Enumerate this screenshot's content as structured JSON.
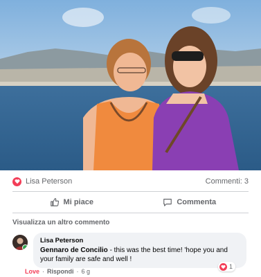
{
  "post": {
    "reaction_name": "Lisa Peterson",
    "comments_count": "Commenti: 3",
    "like_label": "Mi piace",
    "comment_label": "Commenta"
  },
  "comments": {
    "view_more": "Visualizza un altro commento",
    "item": {
      "author": "Lisa Peterson",
      "mention": "Gennaro de Concilio",
      "text": " - this was the best time! 'hope you and your family are safe and well !",
      "love_label": "Love",
      "reply_label": "Rispondi",
      "separator": "·",
      "time": "6 g",
      "reaction_count": "1"
    }
  },
  "colors": {
    "love": "#f33e58",
    "meta": "#65676b",
    "bubble": "#f0f2f5"
  },
  "icons": [
    "heart-icon",
    "thumbs-up-icon",
    "comment-icon",
    "online-dot"
  ]
}
